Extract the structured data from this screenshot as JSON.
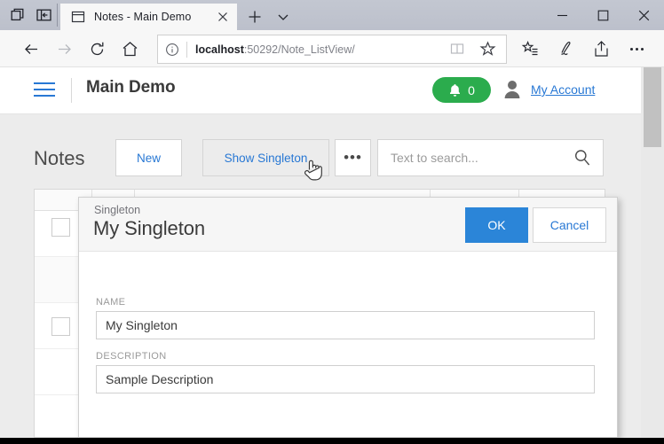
{
  "browser": {
    "tab": {
      "title": "Notes - Main Demo",
      "favicon_icon": "window-icon",
      "close_icon": "close-icon"
    },
    "new_tab_icon": "plus-icon",
    "tab_menu_icon": "chevron-down-icon",
    "title_left_icons": [
      "tab-preview-icon",
      "set-aside-tabs-icon"
    ],
    "window_controls": {
      "minimize": "minimize-icon",
      "maximize": "maximize-icon",
      "close": "close-icon"
    },
    "nav": {
      "back_icon": "back-arrow-icon",
      "forward_icon": "forward-arrow-icon",
      "refresh_icon": "refresh-icon",
      "home_icon": "home-icon"
    },
    "address": {
      "info_icon": "info-icon",
      "host": "localhost",
      "path": ":50292/Note_ListView/",
      "full": "localhost:50292/Note_ListView/",
      "reading_view_icon": "book-icon",
      "favorite_icon": "star-icon"
    },
    "toolbar_icons": [
      "favorites-hub-icon",
      "web-note-icon",
      "share-icon",
      "settings-more-icon"
    ]
  },
  "app_header": {
    "menu_icon": "hamburger-icon",
    "title": "Main Demo",
    "notifications": {
      "icon": "bell-icon",
      "count": "0",
      "color": "#2bac4d"
    },
    "user_icon": "person-icon",
    "account_link": "My Account",
    "link_color": "#2878d4"
  },
  "toolbar": {
    "page_title": "Notes",
    "new_label": "New",
    "show_singleton_label": "Show Singleton",
    "overflow_label": "•••",
    "search": {
      "value": "",
      "placeholder": "Text to search...",
      "icon": "search-icon"
    }
  },
  "grid": {
    "select_all_checkbox": "",
    "row_checkbox": "",
    "columns": [
      "",
      "",
      "",
      "",
      ""
    ]
  },
  "dialog": {
    "kicker": "Singleton",
    "title": "My Singleton",
    "ok_label": "OK",
    "cancel_label": "Cancel",
    "ok_color": "#2b85d8",
    "fields": [
      {
        "label": "NAME",
        "value": "My Singleton",
        "placeholder": ""
      },
      {
        "label": "DESCRIPTION",
        "value": "Sample Description",
        "placeholder": ""
      }
    ]
  },
  "cursor": {
    "icon": "pointer-hand-icon"
  }
}
